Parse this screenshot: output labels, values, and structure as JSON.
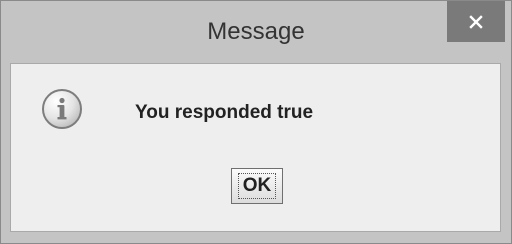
{
  "dialog": {
    "title": "Message",
    "message": "You responded true",
    "ok_label": "OK"
  },
  "icons": {
    "main": "information-icon",
    "close": "close-icon"
  }
}
